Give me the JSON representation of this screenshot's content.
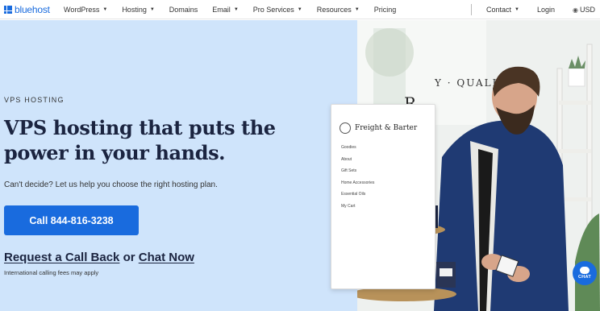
{
  "nav": {
    "logo_text": "bluehost",
    "items": [
      {
        "label": "WordPress",
        "has_caret": true
      },
      {
        "label": "Hosting",
        "has_caret": true
      },
      {
        "label": "Domains",
        "has_caret": false
      },
      {
        "label": "Email",
        "has_caret": true
      },
      {
        "label": "Pro Services",
        "has_caret": true
      },
      {
        "label": "Resources",
        "has_caret": true
      },
      {
        "label": "Pricing",
        "has_caret": false
      }
    ],
    "contact_label": "Contact",
    "login_label": "Login",
    "currency_label": "USD",
    "caret_glyph": "▼",
    "brand_color": "#196bde"
  },
  "hero": {
    "eyebrow": "VPS HOSTING",
    "headline": "VPS hosting that puts the power in your hands.",
    "subtext": "Can't decide? Let us help you choose the right hosting plan.",
    "call_button": "Call 844-816-3238",
    "request_callback": "Request a Call Back",
    "or_text": "or",
    "chat_now": "Chat Now",
    "fees_note": "International calling fees may apply",
    "background_color": "#cfe4fb"
  },
  "photo": {
    "store_sign_text": "Y · QUALITY",
    "mockup": {
      "brand": "Freight & Barter",
      "menu": [
        "Goodies",
        "About",
        "Gift Sets",
        "Home Accessories",
        "Essential Oils",
        "My Cart"
      ]
    }
  },
  "chat_widget": {
    "label": "CHAT"
  }
}
